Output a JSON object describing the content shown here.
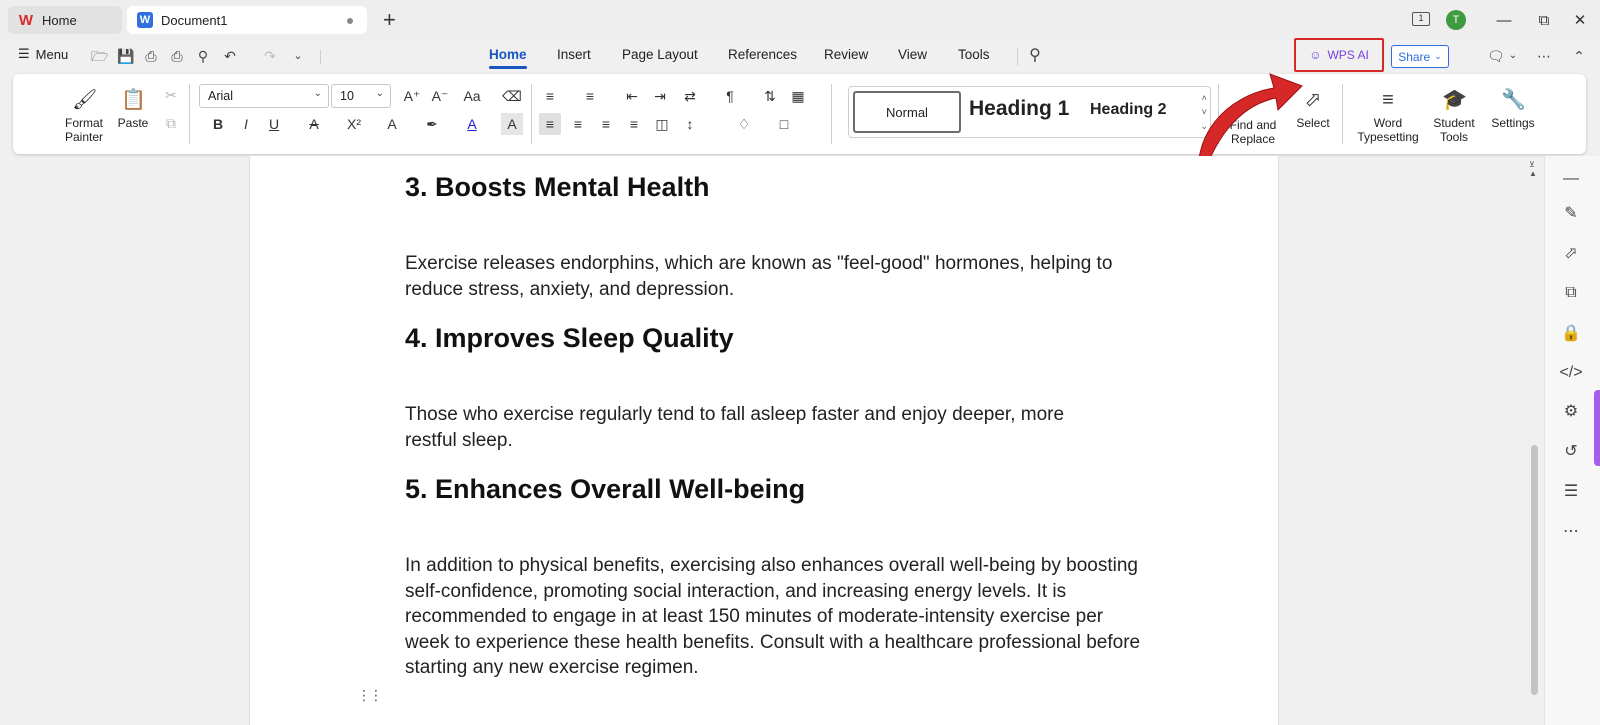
{
  "tabs": {
    "home_label": "Home",
    "document_label": "Document1"
  },
  "user": {
    "avatar_initial": "T",
    "page_count_badge": "1"
  },
  "menu": {
    "menu_label": "Menu",
    "nav_tabs": [
      "Home",
      "Insert",
      "Page Layout",
      "References",
      "Review",
      "View",
      "Tools"
    ],
    "wps_ai_label": "WPS AI",
    "share_label": "Share"
  },
  "ribbon": {
    "format_painter": "Format Painter",
    "paste": "Paste",
    "font_name": "Arial",
    "font_size": "10",
    "styles": {
      "normal": "Normal",
      "heading1": "Heading 1",
      "heading2": "Heading 2"
    },
    "find_replace": "Find and Replace",
    "select": "Select",
    "word_typesetting": "Word Typesetting",
    "student_tools": "Student Tools",
    "settings": "Settings"
  },
  "document": {
    "sections": [
      {
        "heading": "3. Boosts Mental Health",
        "body": "Exercise releases endorphins, which are known as \"feel-good\" hormones, helping to reduce stress, anxiety, and depression."
      },
      {
        "heading": "4. Improves Sleep Quality",
        "body": "Those who exercise regularly tend to fall asleep faster and enjoy deeper, more restful sleep."
      },
      {
        "heading": "5. Enhances Overall Well-being",
        "body": "In addition to physical benefits, exercising also enhances overall well-being by boosting self-confidence, promoting social interaction, and increasing energy levels. It is recommended to engage in at least 150 minutes of moderate-intensity exercise per week to experience these health benefits. Consult with a healthcare professional before starting any new exercise regimen."
      }
    ]
  },
  "colors": {
    "accent": "#1a56c2",
    "highlight_box": "#d62828",
    "ai_purple": "#7a3fe0"
  }
}
